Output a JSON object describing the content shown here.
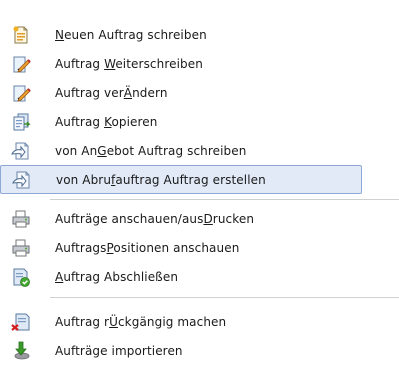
{
  "menu": {
    "items": [
      {
        "pre": "",
        "ul": "N",
        "post": "euen Auftrag schreiben",
        "icon": "new-document-icon"
      },
      {
        "pre": "Auftrag ",
        "ul": "W",
        "post": "eiterschreiben",
        "icon": "edit-pencil-icon"
      },
      {
        "pre": "Auftrag ver",
        "ul": "Ä",
        "post": "ndern",
        "icon": "edit-pencil-icon"
      },
      {
        "pre": "Auftrag ",
        "ul": "K",
        "post": "opieren",
        "icon": "copy-document-icon"
      },
      {
        "pre": "von An",
        "ul": "G",
        "post": "ebot Auftrag schreiben",
        "icon": "document-arrow-icon"
      },
      {
        "pre": "von Abru",
        "ul": "f",
        "post": "auftrag Auftrag erstellen",
        "icon": "document-arrow-icon"
      },
      {
        "pre": "Aufträge anschauen/aus",
        "ul": "D",
        "post": "rucken",
        "icon": "printer-icon"
      },
      {
        "pre": "Auftrags",
        "ul": "P",
        "post": "ositionen anschauen",
        "icon": "printer-icon"
      },
      {
        "pre": "",
        "ul": "A",
        "post": "uftrag Abschließen",
        "icon": "document-check-icon"
      },
      {
        "pre": "Auftrag r",
        "ul": "Ü",
        "post": "ckgängig machen",
        "icon": "document-undo-icon"
      },
      {
        "pre": "Aufträge importieren",
        "ul": "",
        "post": "",
        "icon": "import-arrow-icon"
      }
    ],
    "selected_index": 5
  },
  "colors": {
    "selection_bg": "#e2eaf7",
    "selection_border": "#8fa9d4",
    "separator": "#d0d0d0"
  }
}
